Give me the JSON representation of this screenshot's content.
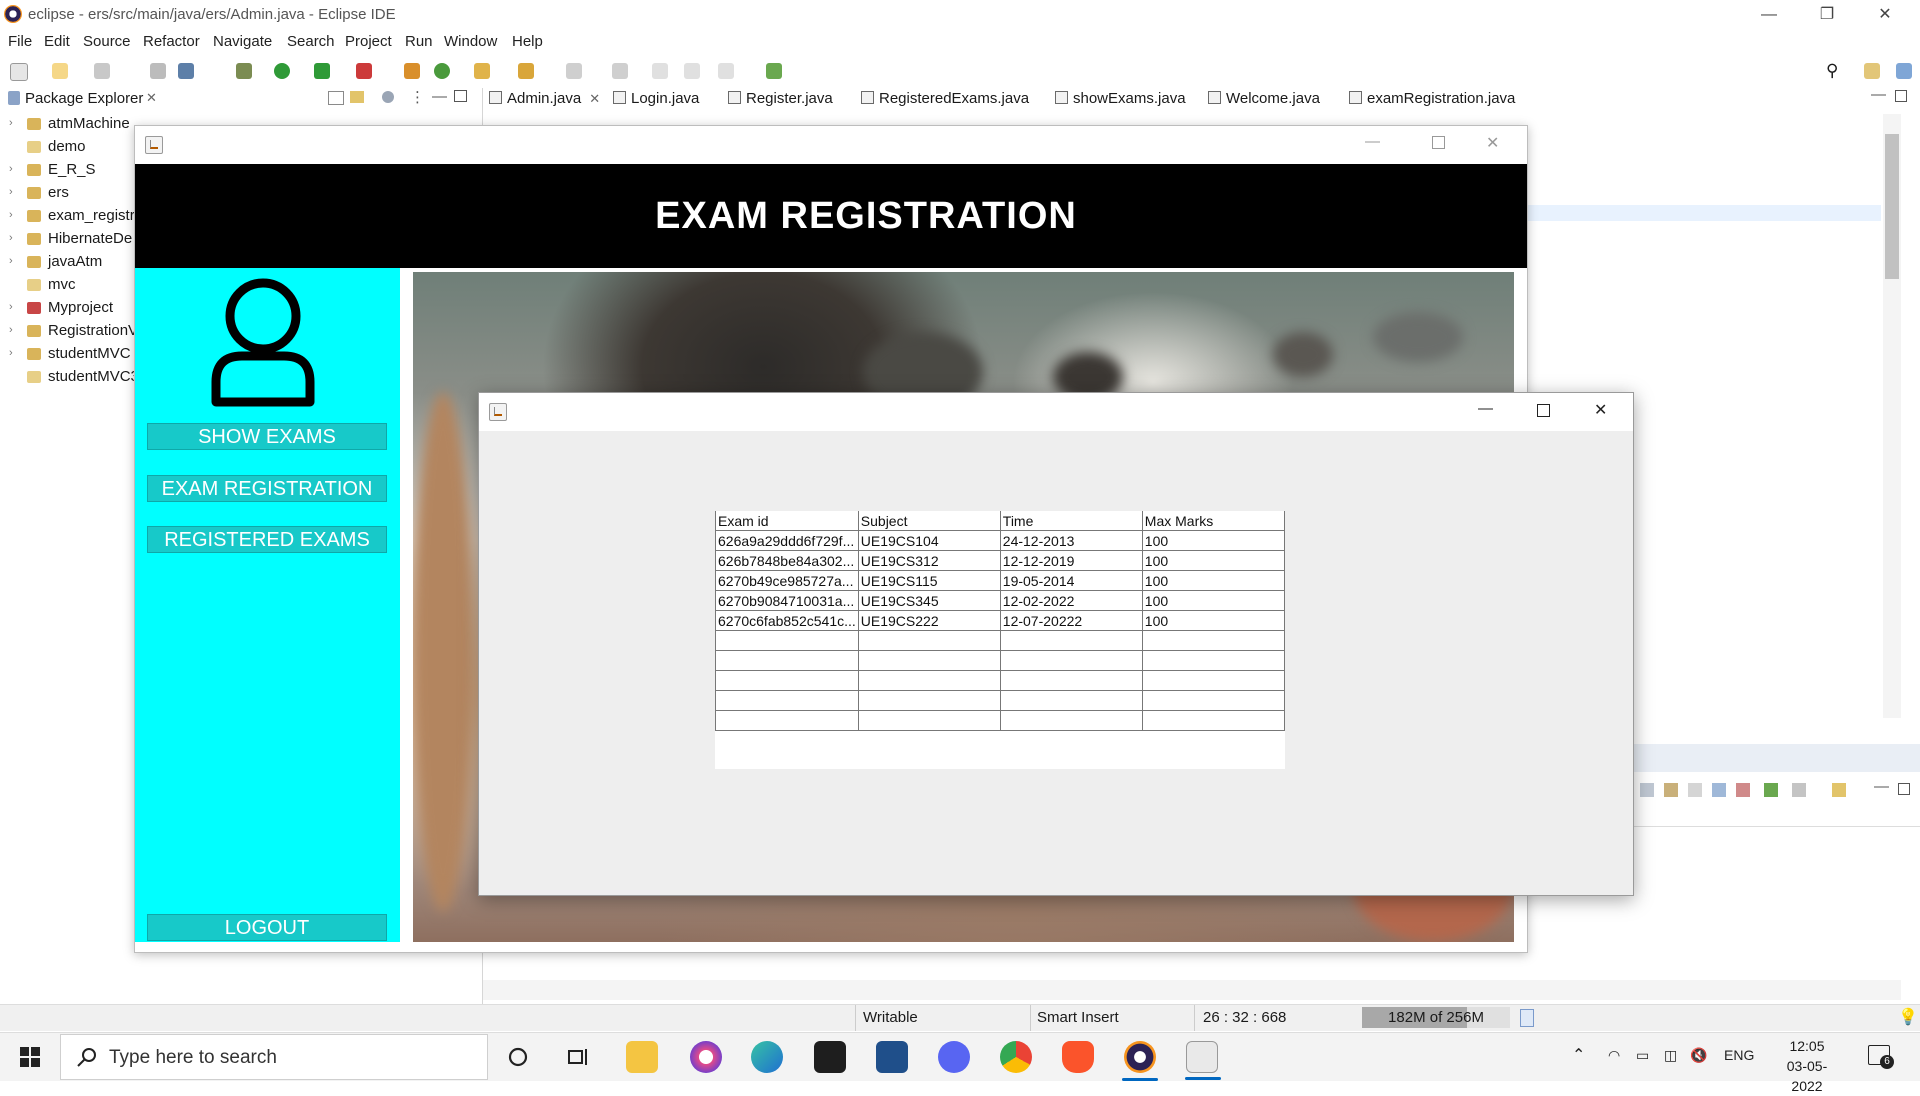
{
  "eclipse": {
    "title": "eclipse - ers/src/main/java/ers/Admin.java - Eclipse IDE",
    "window_controls": {
      "minimize": "—",
      "restore": "❐",
      "close": "✕"
    },
    "menu": [
      "File",
      "Edit",
      "Source",
      "Refactor",
      "Navigate",
      "Search",
      "Project",
      "Run",
      "Window",
      "Help"
    ],
    "package_explorer": {
      "label": "Package Explorer",
      "items": [
        {
          "label": "atmMachine",
          "expandable": true
        },
        {
          "label": "demo",
          "expandable": false
        },
        {
          "label": "E_R_S",
          "expandable": true
        },
        {
          "label": "ers",
          "expandable": true
        },
        {
          "label": "exam_registr",
          "expandable": true
        },
        {
          "label": "HibernateDe",
          "expandable": true
        },
        {
          "label": "javaAtm",
          "expandable": true
        },
        {
          "label": "mvc",
          "expandable": false
        },
        {
          "label": "Myproject",
          "expandable": true
        },
        {
          "label": "RegistrationV",
          "expandable": true
        },
        {
          "label": "studentMVC",
          "expandable": true
        },
        {
          "label": "studentMVC3",
          "expandable": false
        }
      ]
    },
    "editor_tabs": [
      "Admin.java",
      "Login.java",
      "Register.java",
      "RegisteredExams.java",
      "showExams.java",
      "Welcome.java",
      "examRegistration.java"
    ],
    "status": {
      "writable": "Writable",
      "insert_mode": "Smart Insert",
      "position": "26 : 32 : 668",
      "heap": "182M of 256M",
      "heap_used_fraction": 0.71
    }
  },
  "app": {
    "header_title": "EXAM REGISTRATION",
    "buttons": {
      "show_exams": "SHOW EXAMS",
      "exam_registration": "EXAM REGISTRATION",
      "registered_exams": "REGISTERED EXAMS",
      "logout": "LOGOUT"
    }
  },
  "exams_table": {
    "columns": [
      "Exam id",
      "Subject",
      "Time",
      "Max Marks"
    ],
    "rows": [
      [
        "626a9a29ddd6f729f...",
        "UE19CS104",
        "24-12-2013",
        "100"
      ],
      [
        "626b7848be84a302...",
        "UE19CS312",
        "12-12-2019",
        "100"
      ],
      [
        "6270b49ce985727a...",
        "UE19CS115",
        "19-05-2014",
        "100"
      ],
      [
        "6270b9084710031a...",
        "UE19CS345",
        "12-02-2022",
        "100"
      ],
      [
        "6270c6fab852c541c...",
        "UE19CS222",
        "12-07-20222",
        "100"
      ],
      [
        "",
        "",
        "",
        ""
      ],
      [
        "",
        "",
        "",
        ""
      ],
      [
        "",
        "",
        "",
        ""
      ],
      [
        "",
        "",
        "",
        ""
      ],
      [
        "",
        "",
        "",
        ""
      ]
    ]
  },
  "taskbar": {
    "search_placeholder": "Type here to search",
    "language": "ENG",
    "time": "12:05",
    "date": "03-05-2022",
    "notification_count": "6"
  },
  "colors": {
    "sidebar": "#00ffff",
    "sidebar_button": "#17c9c9",
    "header": "#000000"
  }
}
